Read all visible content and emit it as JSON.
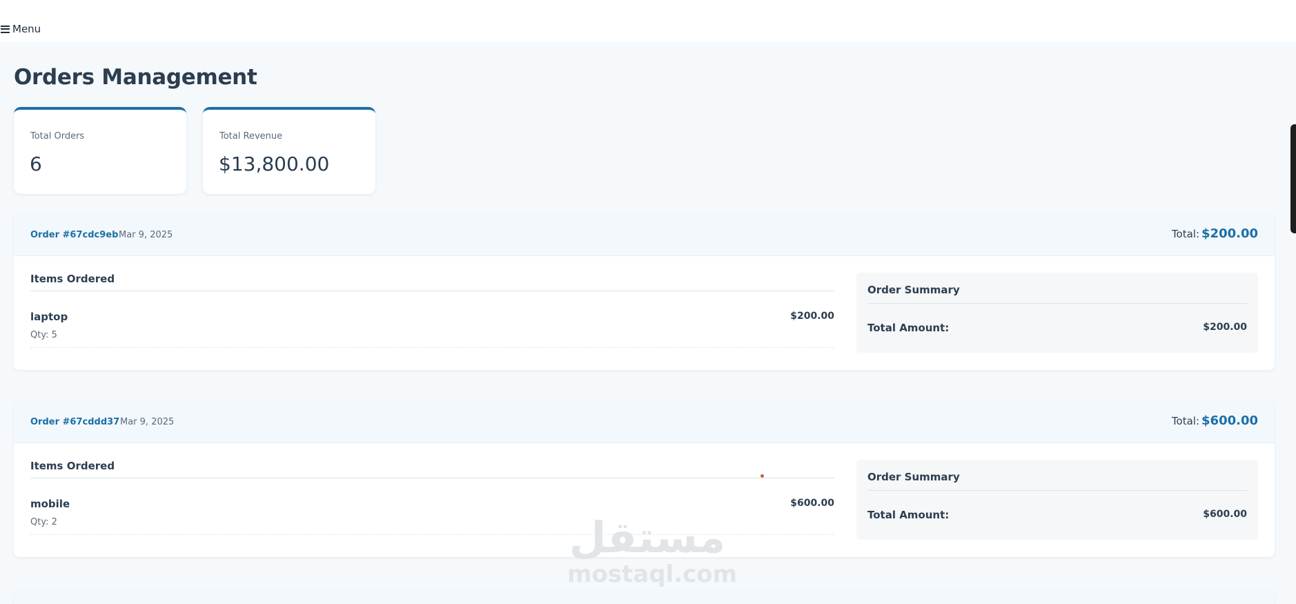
{
  "header": {
    "menu_label": "Menu"
  },
  "page": {
    "title": "Orders Management"
  },
  "stats": [
    {
      "label": "Total Orders",
      "value": "6"
    },
    {
      "label": "Total Revenue",
      "value": "$13,800.00"
    }
  ],
  "orders": [
    {
      "id": "Order #67cdc9eb",
      "date": "Mar 9, 2025",
      "total_label": "Total:",
      "total": "$200.00",
      "items_title": "Items Ordered",
      "items": [
        {
          "name": "laptop",
          "qty": "Qty: 5",
          "price": "$200.00"
        }
      ],
      "summary_title": "Order Summary",
      "summary_label": "Total Amount:",
      "summary_value": "$200.00"
    },
    {
      "id": "Order #67cddd37",
      "date": "Mar 9, 2025",
      "total_label": "Total:",
      "total": "$600.00",
      "items_title": "Items Ordered",
      "items": [
        {
          "name": "mobile",
          "qty": "Qty: 2",
          "price": "$600.00"
        }
      ],
      "summary_title": "Order Summary",
      "summary_label": "Total Amount:",
      "summary_value": "$600.00"
    }
  ],
  "watermark": {
    "arabic": "مستقل",
    "latin": "mostaql.com"
  },
  "colors": {
    "accent": "#1a6fa8",
    "background": "#f5f9fc",
    "text": "#2c3e50"
  }
}
